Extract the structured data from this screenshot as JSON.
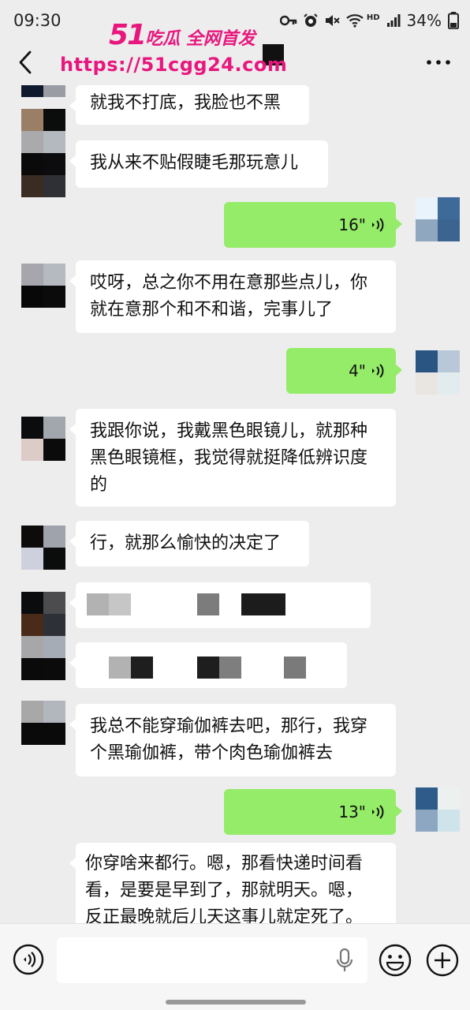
{
  "status_bar": {
    "time": "09:30",
    "hd": "HD",
    "battery": "34%"
  },
  "watermark": {
    "line1_num": "51",
    "line1_text": "吃瓜 全网首发",
    "line2": "https://51cgg24.com",
    "color": "#e8177e"
  },
  "header": {
    "back_icon": "chevron-left-icon",
    "more_icon": "ellipsis-icon"
  },
  "messages": [
    {
      "side": "left",
      "type": "text",
      "lines": [
        "就我不打底，我脸也不黑"
      ]
    },
    {
      "side": "left",
      "type": "text",
      "lines": [
        "我从来不贴假睫毛那玩意儿"
      ]
    },
    {
      "side": "right",
      "type": "voice",
      "duration": "16\""
    },
    {
      "side": "left",
      "type": "text",
      "lines": [
        "哎呀，总之你不用在意那些点儿，你",
        "就在意那个和不和谐，完事儿了"
      ]
    },
    {
      "side": "right",
      "type": "voice",
      "duration": "4\""
    },
    {
      "side": "left",
      "type": "text",
      "lines": [
        "我跟你说，我戴黑色眼镜儿，就那种",
        "黑色眼镜框，我觉得就挺降低辨识度",
        "的"
      ]
    },
    {
      "side": "left",
      "type": "text",
      "lines": [
        "行，就那么愉快的决定了"
      ]
    },
    {
      "side": "left",
      "type": "redacted"
    },
    {
      "side": "left",
      "type": "redacted"
    },
    {
      "side": "left",
      "type": "text",
      "lines": [
        "我总不能穿瑜伽裤去吧，那行，我穿",
        "个黑瑜伽裤，带个肉色瑜伽裤去"
      ]
    },
    {
      "side": "right",
      "type": "voice",
      "duration": "13\""
    },
    {
      "side": "left",
      "type": "text",
      "lines": [
        "你穿啥来都行。嗯，那看快递时间看",
        "看，是要是早到了，那就明天。嗯，",
        "反正最晚就后儿天这事儿就定死了。"
      ]
    }
  ],
  "input_bar": {
    "voice_icon": "voice-toggle-icon",
    "mic_icon": "microphone-icon",
    "emoji_icon": "emoji-icon",
    "plus_icon": "plus-icon",
    "text": ""
  },
  "colors": {
    "background": "#ededed",
    "bubble_left": "#ffffff",
    "bubble_right": "#95ec69"
  }
}
